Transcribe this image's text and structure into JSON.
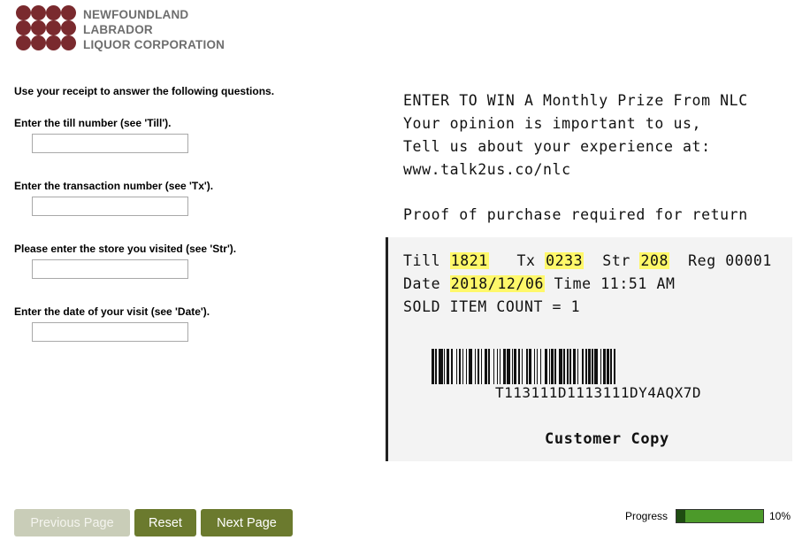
{
  "brand": {
    "line1": "NEWFOUNDLAND",
    "line2": "LABRADOR",
    "line3": "LIQUOR CORPORATION",
    "logo_color": "#7a2a2e",
    "text_color": "#6e6e6e"
  },
  "form": {
    "intro": "Use your receipt to answer the following questions.",
    "questions": [
      {
        "label": "Enter the till number (see 'Till').",
        "value": ""
      },
      {
        "label": "Enter the transaction number (see 'Tx').",
        "value": ""
      },
      {
        "label": "Please enter the store you visited (see 'Str').",
        "value": ""
      },
      {
        "label": "Enter the date of your visit (see 'Date').",
        "value": ""
      }
    ]
  },
  "receipt": {
    "line1": "ENTER TO WIN A Monthly Prize From NLC",
    "line2": "Your opinion is important to us,",
    "line3": "Tell us about your experience at:",
    "line4": "www.talk2us.co/nlc",
    "line5": "Proof of purchase required for return",
    "till_label": "Till",
    "till_value": "1821",
    "tx_label": "Tx",
    "tx_value": "0233",
    "str_label": "Str",
    "str_value": "208",
    "reg": "Reg 00001",
    "date_label": "Date",
    "date_value": "2018/12/06",
    "time": "Time 11:51 AM",
    "count": "SOLD ITEM COUNT = 1",
    "barcode_text": "T113111D1113111DY4AQX7D",
    "copy": "Customer Copy",
    "highlight_color": "#fff86a"
  },
  "buttons": {
    "previous": "Previous Page",
    "reset": "Reset",
    "next": "Next Page",
    "accent": "#6b7a2e"
  },
  "progress": {
    "label": "Progress",
    "percent_text": "10%",
    "fraction": 0.1,
    "bar_color": "#4c9a2a",
    "fill_color": "#1f4d12"
  }
}
